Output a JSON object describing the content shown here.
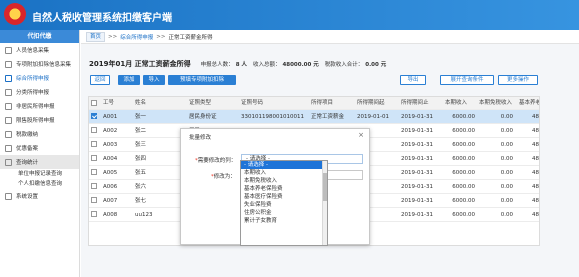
{
  "app": {
    "title": "自然人税收管理系统扣缴客户端"
  },
  "sidebar": {
    "header": "代扣代缴",
    "items": [
      {
        "label": "人员信息采集"
      },
      {
        "label": "专项附加扣除信息采集"
      },
      {
        "label": "综合所得申报"
      },
      {
        "label": "分类所得申报"
      },
      {
        "label": "非居民所得申报"
      },
      {
        "label": "限售股所得申报"
      },
      {
        "label": "税款缴纳"
      },
      {
        "label": "优惠备案"
      },
      {
        "label": "查询统计"
      }
    ],
    "sub_items": [
      {
        "label": "单位申报记录查询"
      },
      {
        "label": "个人扣缴信息查询"
      }
    ],
    "footer_item": {
      "label": "系统设置"
    }
  },
  "breadcrumb": {
    "tab": "首页",
    "items": [
      "综合所得申报",
      "正常工资薪金所得"
    ],
    "separators": [
      ">>",
      ">>"
    ]
  },
  "summary": {
    "title": "2019年01月 正常工资薪金所得",
    "count_label": "申报总人数：",
    "count_value": "8 人",
    "income_label": "收入总额：",
    "income_value": "48000.00 元",
    "tax_label": "税款收入合计：",
    "tax_value": "0.00 元"
  },
  "toolbar": {
    "back": "返回",
    "add": "添加",
    "import": "导入",
    "preset": "预填专项附加扣除",
    "export": "导出",
    "expand": "展开查询条件",
    "more": "更多操作"
  },
  "table": {
    "columns": [
      "工号",
      "姓名",
      "证照类型",
      "证照号码",
      "所得项目",
      "所得期间起",
      "所得期间止",
      "本期收入",
      "本期免税收入",
      "基本养老保"
    ],
    "rows": [
      {
        "checked": true,
        "selected": true,
        "id": "A001",
        "name": "张一",
        "type": "居民身份证",
        "number": "330101198001010011",
        "item": "正常工资薪金",
        "start": "2019-01-01",
        "end": "2019-01-31",
        "income": "6000.00",
        "free": "0.00",
        "pension": "48"
      },
      {
        "checked": false,
        "selected": false,
        "id": "A002",
        "name": "张二",
        "type": "居民",
        "number": "",
        "item": "",
        "start": "",
        "end": "2019-01-31",
        "income": "6000.00",
        "free": "0.00",
        "pension": "48"
      },
      {
        "checked": false,
        "selected": false,
        "id": "A003",
        "name": "张三",
        "type": "居民",
        "number": "",
        "item": "",
        "start": "",
        "end": "2019-01-31",
        "income": "6000.00",
        "free": "0.00",
        "pension": "48"
      },
      {
        "checked": false,
        "selected": false,
        "id": "A004",
        "name": "张四",
        "type": "居民",
        "number": "",
        "item": "",
        "start": "",
        "end": "2019-01-31",
        "income": "6000.00",
        "free": "0.00",
        "pension": "48"
      },
      {
        "checked": false,
        "selected": false,
        "id": "A005",
        "name": "张五",
        "type": "居民",
        "number": "",
        "item": "",
        "start": "",
        "end": "2019-01-31",
        "income": "6000.00",
        "free": "0.00",
        "pension": "48"
      },
      {
        "checked": false,
        "selected": false,
        "id": "A006",
        "name": "张六",
        "type": "居民",
        "number": "",
        "item": "",
        "start": "",
        "end": "2019-01-31",
        "income": "6000.00",
        "free": "0.00",
        "pension": "48"
      },
      {
        "checked": false,
        "selected": false,
        "id": "A007",
        "name": "张七",
        "type": "居民",
        "number": "",
        "item": "",
        "start": "",
        "end": "2019-01-31",
        "income": "6000.00",
        "free": "0.00",
        "pension": "48"
      },
      {
        "checked": false,
        "selected": false,
        "id": "A008",
        "name": "uu123",
        "type": "外国",
        "number": "",
        "item": "",
        "start": "",
        "end": "2019-01-31",
        "income": "6000.00",
        "free": "0.00",
        "pension": "48"
      }
    ]
  },
  "dialog": {
    "title": "批量修改",
    "close": "×",
    "field_label": "需要修改的列：",
    "field_required": "*",
    "field_value": "- 请选择 -",
    "value_label": "修改为：",
    "value_required": "*"
  },
  "dropdown": {
    "options": [
      "- 请选择 -",
      "本期收入",
      "本期免税收入",
      "基本养老保险费",
      "基本医疗保险费",
      "失业保险费",
      "住房公积金",
      "累计子女教育"
    ],
    "highlighted_index": 0
  },
  "colors": {
    "primary": "#2a7fd4",
    "header": "#1a72c4",
    "selected_row": "#cfe4f8",
    "highlight": "#1e74d8"
  }
}
